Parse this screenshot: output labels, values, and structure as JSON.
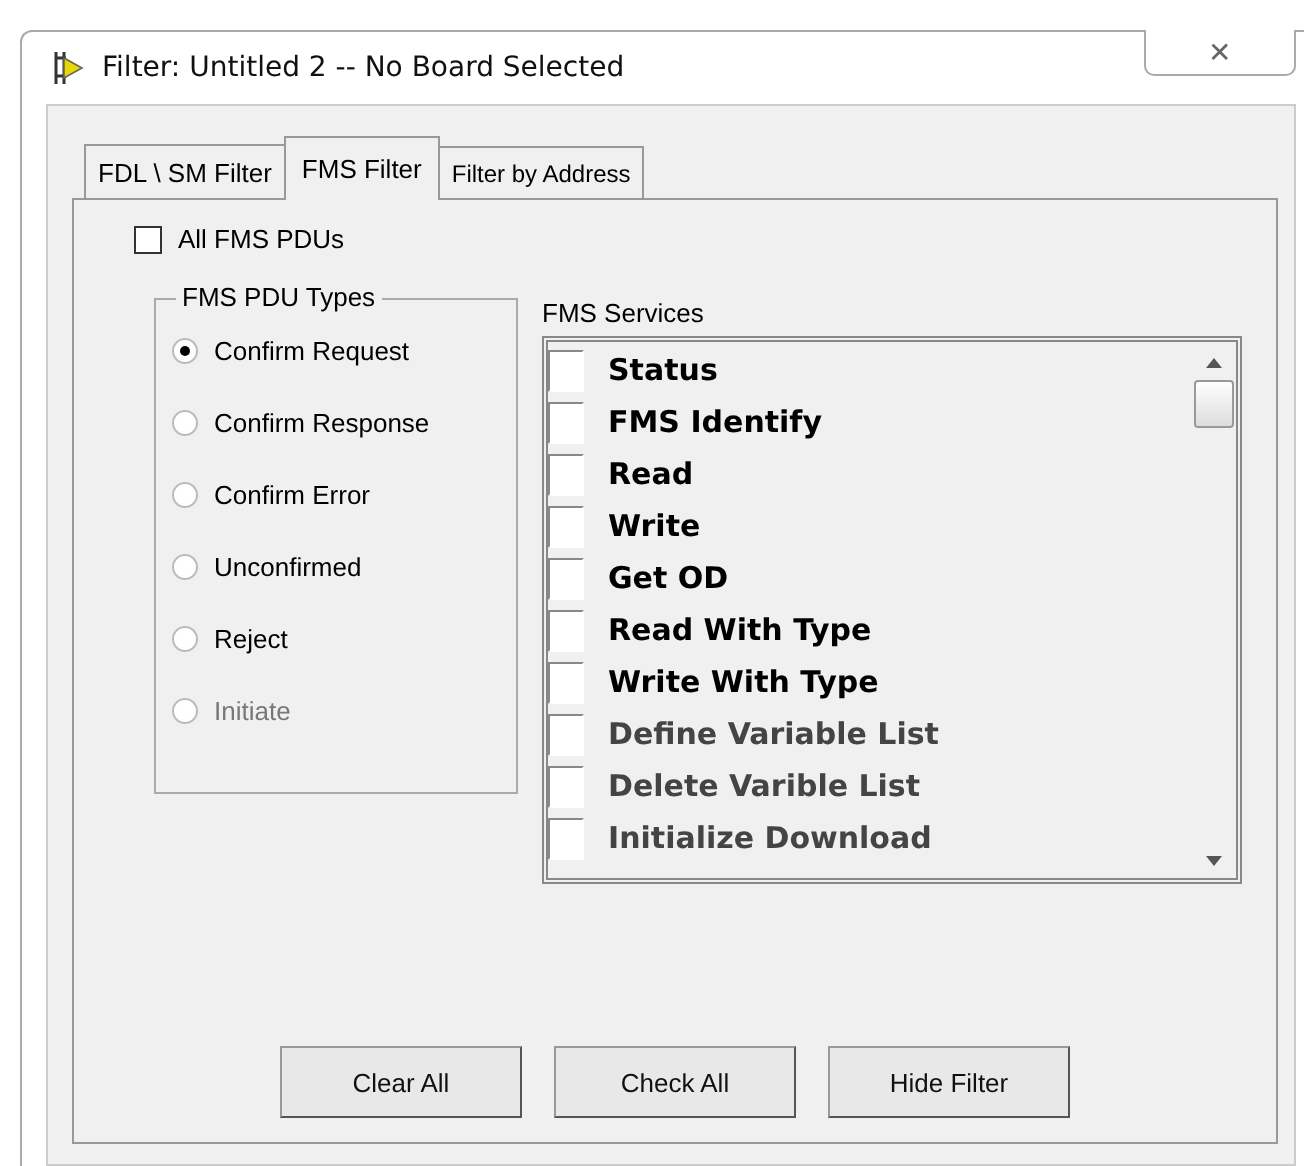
{
  "window": {
    "title": "Filter: Untitled 2 -- No Board Selected",
    "close": "✕"
  },
  "tabs": [
    {
      "label": "FDL \\ SM Filter",
      "selected": false
    },
    {
      "label": "FMS Filter",
      "selected": true
    },
    {
      "label": "Filter by Address",
      "selected": false
    }
  ],
  "all_pdus": {
    "label": "All FMS PDUs",
    "checked": false
  },
  "pdu_types": {
    "title": "FMS PDU Types",
    "options": [
      {
        "label": "Confirm Request",
        "selected": true,
        "disabled": false
      },
      {
        "label": "Confirm Response",
        "selected": false,
        "disabled": false
      },
      {
        "label": "Confirm Error",
        "selected": false,
        "disabled": false
      },
      {
        "label": "Unconfirmed",
        "selected": false,
        "disabled": false
      },
      {
        "label": "Reject",
        "selected": false,
        "disabled": false
      },
      {
        "label": "Initiate",
        "selected": false,
        "disabled": true
      }
    ]
  },
  "services": {
    "title": "FMS Services",
    "items": [
      {
        "label": "Status",
        "checked": false,
        "disabled": false
      },
      {
        "label": "FMS Identify",
        "checked": false,
        "disabled": false
      },
      {
        "label": "Read",
        "checked": false,
        "disabled": false
      },
      {
        "label": "Write",
        "checked": false,
        "disabled": false
      },
      {
        "label": "Get OD",
        "checked": false,
        "disabled": false
      },
      {
        "label": "Read With Type",
        "checked": false,
        "disabled": false
      },
      {
        "label": "Write With Type",
        "checked": false,
        "disabled": false
      },
      {
        "label": "Define Variable List",
        "checked": false,
        "disabled": true
      },
      {
        "label": "Delete Varible List",
        "checked": false,
        "disabled": true
      },
      {
        "label": "Initialize Download",
        "checked": false,
        "disabled": true
      }
    ]
  },
  "buttons": [
    "Clear All",
    "Check All",
    "Hide Filter"
  ]
}
